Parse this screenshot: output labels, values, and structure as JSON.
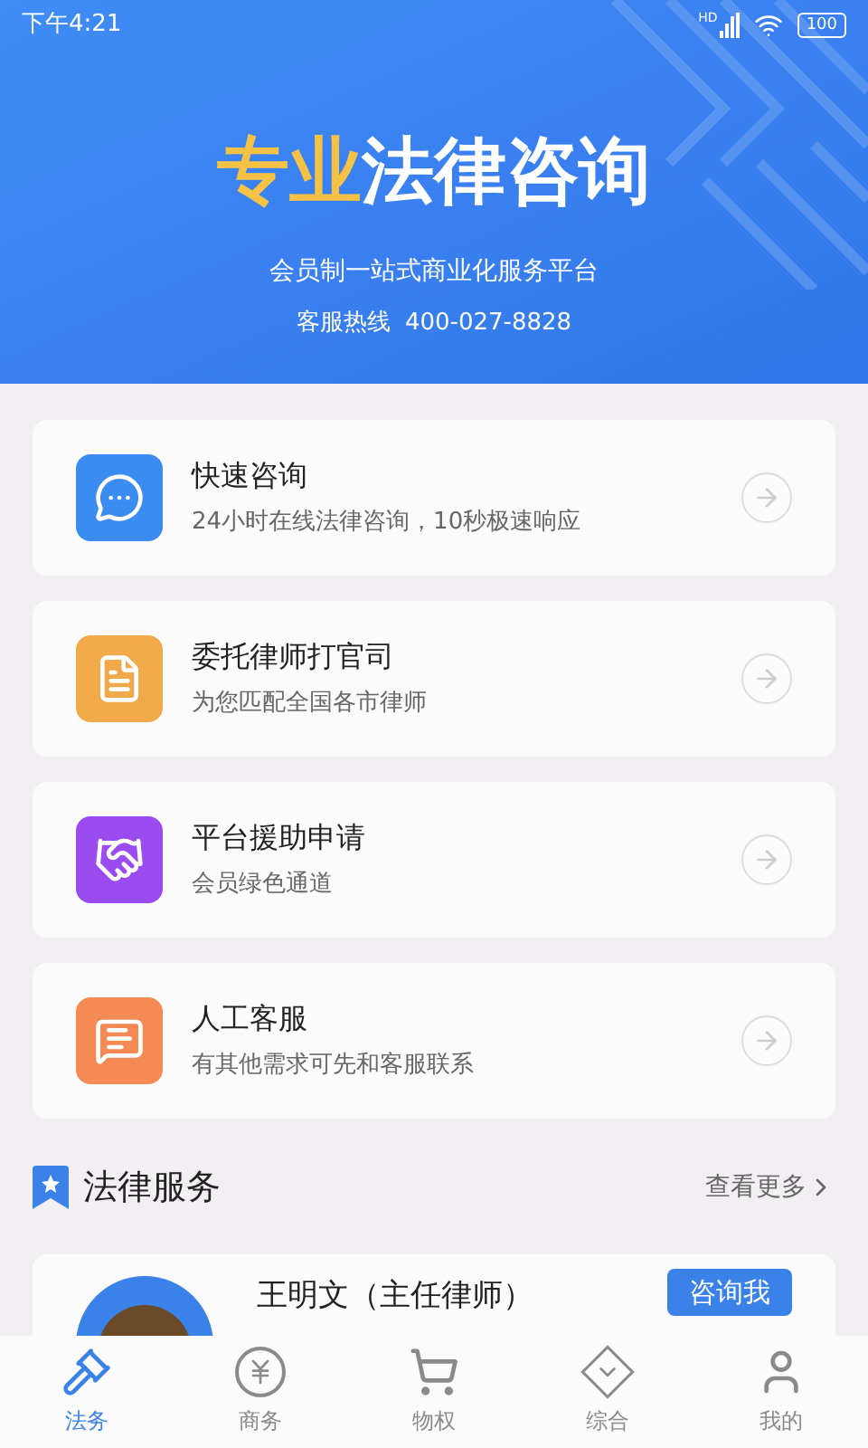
{
  "status_bar": {
    "time": "下午4:21",
    "network": "HD",
    "battery": "100"
  },
  "hero": {
    "title_highlight": "专业",
    "title": "法律咨询",
    "subtitle": "会员制一站式商业化服务平台",
    "hotline_label": "客服热线",
    "hotline": "400-027-8828"
  },
  "services": [
    {
      "kind": "chat",
      "title": "快速咨询",
      "subtitle": "24小时在线法律咨询，10秒极速响应",
      "color": "#3b8cf0"
    },
    {
      "kind": "document",
      "title": "委托律师打官司",
      "subtitle": "为您匹配全国各市律师",
      "color": "#f2a94a"
    },
    {
      "kind": "handshake",
      "title": "平台援助申请",
      "subtitle": "会员绿色通道",
      "color": "#9a4cf0"
    },
    {
      "kind": "service",
      "title": "人工客服",
      "subtitle": "有其他需求可先和客服联系",
      "color": "#f58a55"
    }
  ],
  "section": {
    "title": "法律服务",
    "more": "查看更多"
  },
  "lawyer": {
    "name": "王明文（主任律师）",
    "button": "咨询我"
  },
  "tabs": [
    {
      "kind": "gavel",
      "label": "法务",
      "selected": true
    },
    {
      "kind": "yen",
      "label": "商务",
      "selected": false
    },
    {
      "kind": "cart",
      "label": "物权",
      "selected": false
    },
    {
      "kind": "gem",
      "label": "综合",
      "selected": false
    },
    {
      "kind": "user",
      "label": "我的",
      "selected": false
    }
  ]
}
